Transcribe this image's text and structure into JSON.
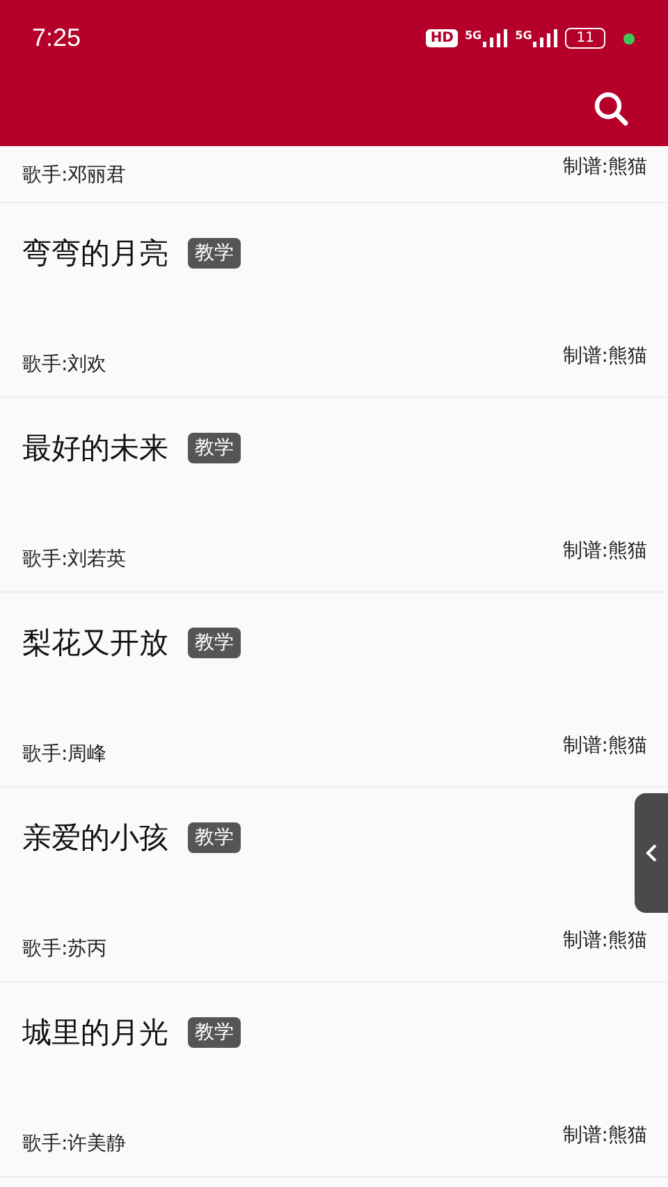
{
  "status_bar": {
    "time": "7:25",
    "hd_label": "HD",
    "networks": [
      {
        "label": "5G"
      },
      {
        "label": "5G"
      }
    ],
    "battery": "11"
  },
  "songs": [
    {
      "kind": "partial",
      "singer": "歌手:邓丽君",
      "credit": "制谱:熊猫"
    },
    {
      "kind": "full",
      "title": "弯弯的月亮",
      "tag": "教学",
      "singer": "歌手:刘欢",
      "credit": "制谱:熊猫"
    },
    {
      "kind": "full",
      "title": "最好的未来",
      "tag": "教学",
      "singer": "歌手:刘若英",
      "credit": "制谱:熊猫"
    },
    {
      "kind": "full",
      "title": "梨花又开放",
      "tag": "教学",
      "singer": "歌手:周峰",
      "credit": "制谱:熊猫"
    },
    {
      "kind": "full",
      "title": "亲爱的小孩",
      "tag": "教学",
      "singer": "歌手:苏丙",
      "credit": "制谱:熊猫"
    },
    {
      "kind": "full",
      "title": "城里的月光",
      "tag": "教学",
      "singer": "歌手:许美静",
      "credit": "制谱:熊猫"
    }
  ]
}
